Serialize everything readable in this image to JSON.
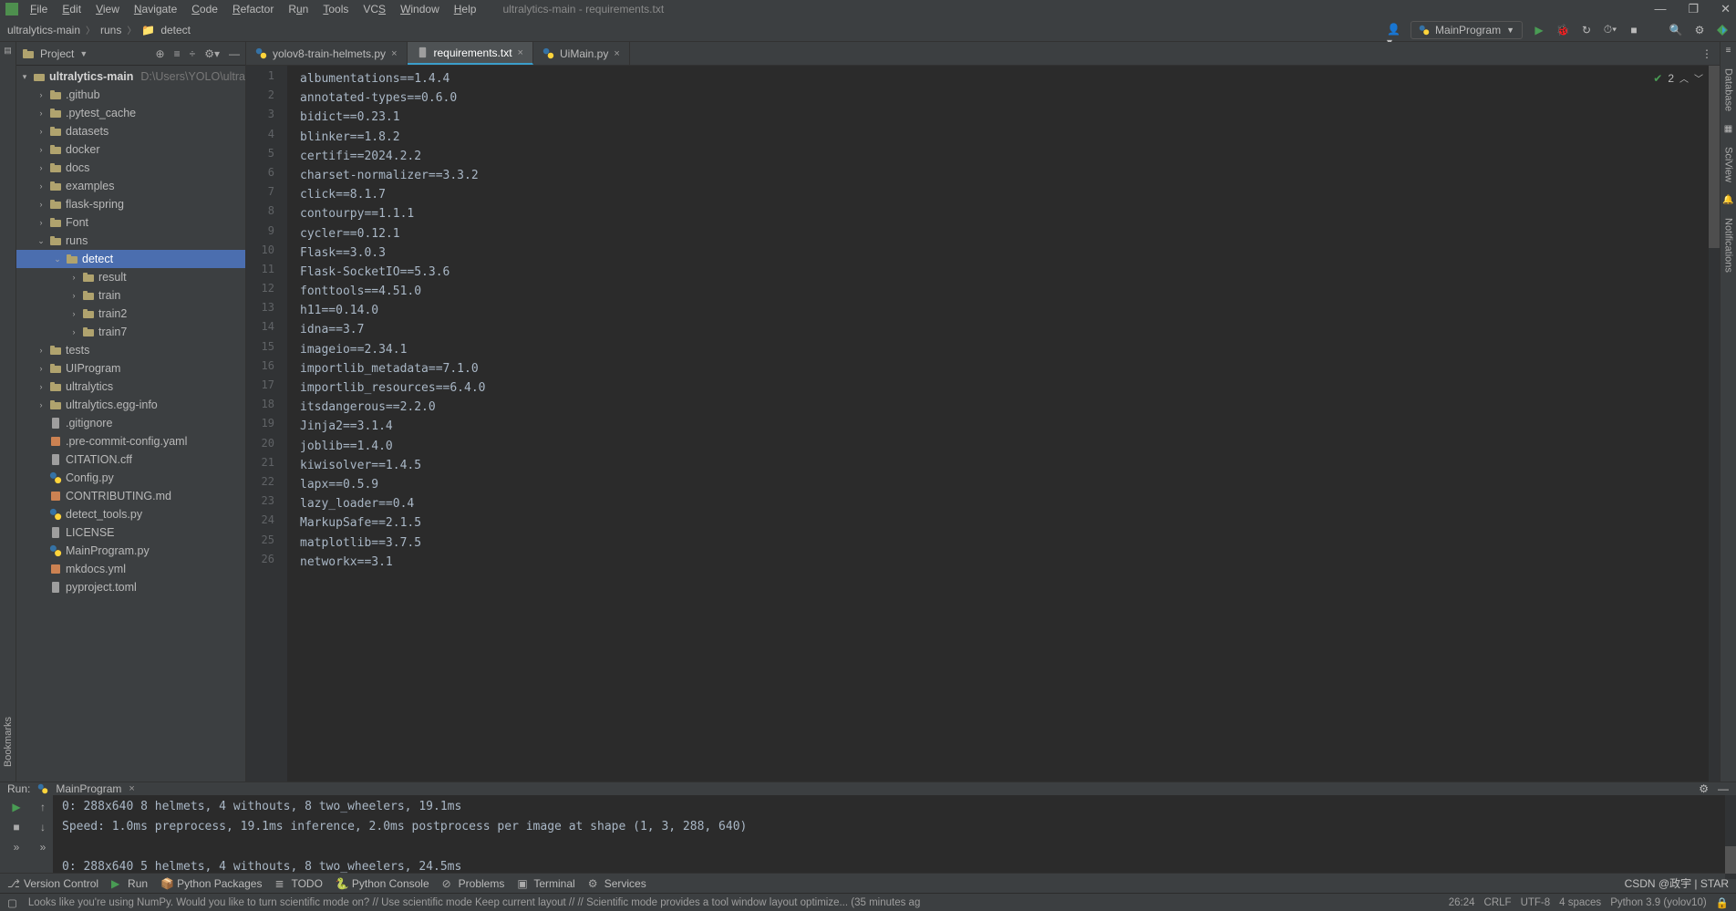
{
  "window_title": "ultralytics-main - requirements.txt",
  "menu": [
    "File",
    "Edit",
    "View",
    "Navigate",
    "Code",
    "Refactor",
    "Run",
    "Tools",
    "VCS",
    "Window",
    "Help"
  ],
  "breadcrumbs": {
    "root": "ultralytics-main",
    "mid": "runs",
    "leaf": "detect"
  },
  "run_config": "MainProgram",
  "project_panel": {
    "title": "Project",
    "root_name": "ultralytics-main",
    "root_path": "D:\\Users\\YOLO\\ultra",
    "items": [
      {
        "indent": 1,
        "arrow": ">",
        "icon": "folder",
        "name": ".github"
      },
      {
        "indent": 1,
        "arrow": ">",
        "icon": "folder",
        "name": ".pytest_cache"
      },
      {
        "indent": 1,
        "arrow": ">",
        "icon": "folder",
        "name": "datasets"
      },
      {
        "indent": 1,
        "arrow": ">",
        "icon": "folder",
        "name": "docker"
      },
      {
        "indent": 1,
        "arrow": ">",
        "icon": "folder",
        "name": "docs"
      },
      {
        "indent": 1,
        "arrow": ">",
        "icon": "folder",
        "name": "examples"
      },
      {
        "indent": 1,
        "arrow": ">",
        "icon": "folder",
        "name": "flask-spring"
      },
      {
        "indent": 1,
        "arrow": ">",
        "icon": "folder",
        "name": "Font"
      },
      {
        "indent": 1,
        "arrow": "v",
        "icon": "folder",
        "name": "runs"
      },
      {
        "indent": 2,
        "arrow": "v",
        "icon": "folder",
        "name": "detect",
        "selected": true
      },
      {
        "indent": 3,
        "arrow": ">",
        "icon": "folder",
        "name": "result"
      },
      {
        "indent": 3,
        "arrow": ">",
        "icon": "folder",
        "name": "train"
      },
      {
        "indent": 3,
        "arrow": ">",
        "icon": "folder",
        "name": "train2"
      },
      {
        "indent": 3,
        "arrow": ">",
        "icon": "folder",
        "name": "train7"
      },
      {
        "indent": 1,
        "arrow": ">",
        "icon": "folder",
        "name": "tests"
      },
      {
        "indent": 1,
        "arrow": ">",
        "icon": "folder",
        "name": "UIProgram"
      },
      {
        "indent": 1,
        "arrow": ">",
        "icon": "folder",
        "name": "ultralytics"
      },
      {
        "indent": 1,
        "arrow": ">",
        "icon": "folder",
        "name": "ultralytics.egg-info"
      },
      {
        "indent": 1,
        "arrow": "",
        "icon": "txt",
        "name": ".gitignore"
      },
      {
        "indent": 1,
        "arrow": "",
        "icon": "md",
        "name": ".pre-commit-config.yaml"
      },
      {
        "indent": 1,
        "arrow": "",
        "icon": "txt",
        "name": "CITATION.cff"
      },
      {
        "indent": 1,
        "arrow": "",
        "icon": "py",
        "name": "Config.py"
      },
      {
        "indent": 1,
        "arrow": "",
        "icon": "md",
        "name": "CONTRIBUTING.md"
      },
      {
        "indent": 1,
        "arrow": "",
        "icon": "py",
        "name": "detect_tools.py"
      },
      {
        "indent": 1,
        "arrow": "",
        "icon": "txt",
        "name": "LICENSE"
      },
      {
        "indent": 1,
        "arrow": "",
        "icon": "py",
        "name": "MainProgram.py"
      },
      {
        "indent": 1,
        "arrow": "",
        "icon": "md",
        "name": "mkdocs.yml"
      },
      {
        "indent": 1,
        "arrow": "",
        "icon": "txt",
        "name": "pyproject.toml"
      }
    ]
  },
  "tabs": [
    {
      "icon": "py",
      "label": "yolov8-train-helmets.py",
      "active": false
    },
    {
      "icon": "txt",
      "label": "requirements.txt",
      "active": true
    },
    {
      "icon": "py",
      "label": "UiMain.py",
      "active": false
    }
  ],
  "inspection_count": "2",
  "code_lines": [
    "albumentations==1.4.4",
    "annotated-types==0.6.0",
    "bidict==0.23.1",
    "blinker==1.8.2",
    "certifi==2024.2.2",
    "charset-normalizer==3.3.2",
    "click==8.1.7",
    "contourpy==1.1.1",
    "cycler==0.12.1",
    "Flask==3.0.3",
    "Flask-SocketIO==5.3.6",
    "fonttools==4.51.0",
    "h11==0.14.0",
    "idna==3.7",
    "imageio==2.34.1",
    "importlib_metadata==7.1.0",
    "importlib_resources==6.4.0",
    "itsdangerous==2.2.0",
    "Jinja2==3.1.4",
    "joblib==1.4.0",
    "kiwisolver==1.4.5",
    "lapx==0.5.9",
    "lazy_loader==0.4",
    "MarkupSafe==2.1.5",
    "matplotlib==3.7.5",
    "networkx==3.1"
  ],
  "run_tab": {
    "title": "Run:",
    "name": "MainProgram"
  },
  "console_lines": [
    "0: 288x640 8 helmets, 4 withouts, 8 two_wheelers, 19.1ms",
    "Speed: 1.0ms preprocess, 19.1ms inference, 2.0ms postprocess per image at shape (1, 3, 288, 640)",
    "",
    "0: 288x640 5 helmets, 4 withouts, 8 two_wheelers, 24.5ms"
  ],
  "bottom_tools": [
    "Version Control",
    "Run",
    "Python Packages",
    "TODO",
    "Python Console",
    "Problems",
    "Terminal",
    "Services"
  ],
  "status": {
    "tip": "Looks like you're using NumPy. Would you like to turn scientific mode on? // Use scientific mode   Keep current layout // // Scientific mode provides a tool window layout optimize... (35 minutes ag",
    "caret": "26:24",
    "sep": "CRLF",
    "enc": "UTF-8",
    "indent": "4 spaces",
    "py": "Python 3.9 (yolov10)",
    "watermark": "CSDN @政宇 | STAR"
  },
  "side_labels": {
    "left": "Bookmarks",
    "right1": "Database",
    "right2": "SciView",
    "right3": "Notifications"
  }
}
